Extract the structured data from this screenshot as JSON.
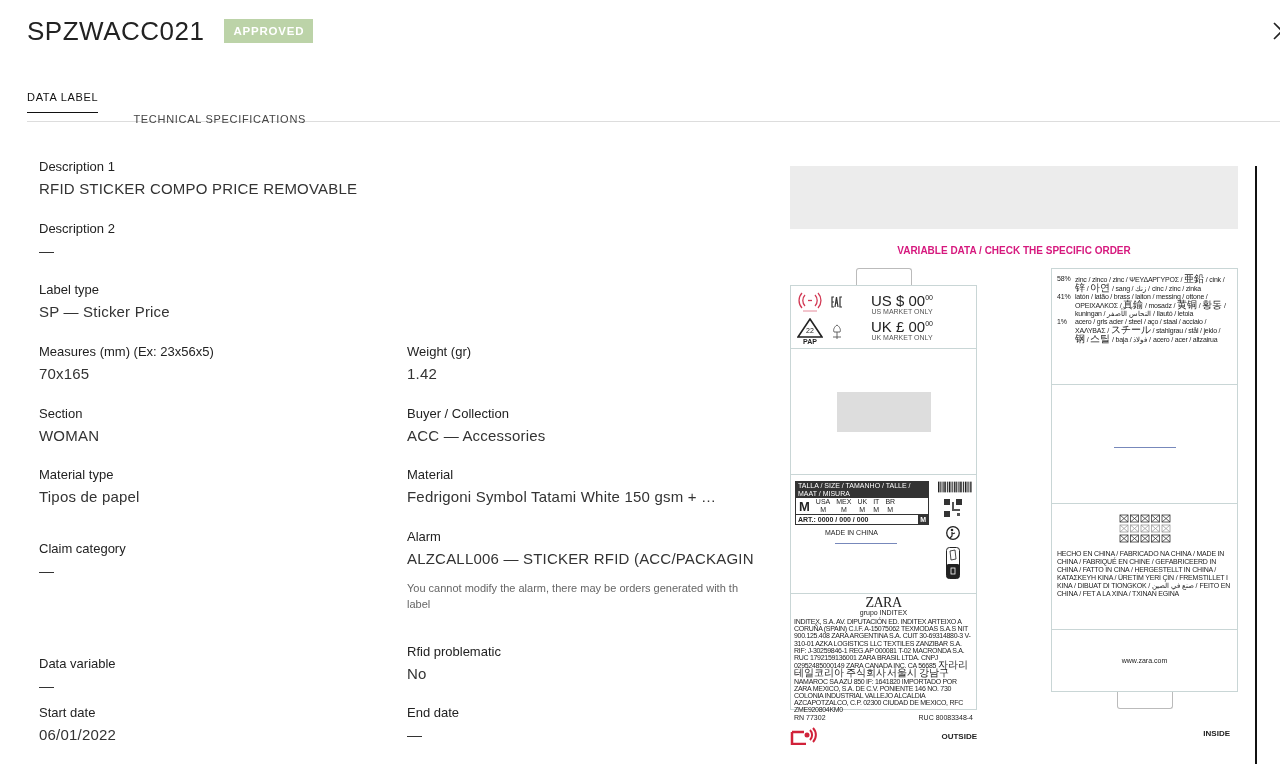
{
  "header": {
    "title": "SPZWACC021",
    "status": "APPROVED"
  },
  "tabs": [
    {
      "label": "DATA LABEL",
      "selected": true
    },
    {
      "label": "TECHNICAL SPECIFICATIONS",
      "selected": false
    }
  ],
  "fields": [
    {
      "left": {
        "label": "Description 1",
        "value": "RFID STICKER COMPO PRICE REMOVABLE"
      }
    },
    {
      "left": {
        "label": "Description 2",
        "value": "—"
      }
    },
    {
      "left": {
        "label": "Label type",
        "value": "SP — Sticker Price"
      }
    },
    {
      "left": {
        "label": "Measures (mm) (Ex: 23x56x5)",
        "value": "70x165"
      },
      "right": {
        "label": "Weight (gr)",
        "value": "1.42"
      }
    },
    {
      "left": {
        "label": "Section",
        "value": "WOMAN"
      },
      "right": {
        "label": "Buyer / Collection",
        "value": "ACC — Accessories"
      }
    },
    {
      "left": {
        "label": "Material type",
        "value": "Tipos de papel"
      },
      "right": {
        "label": "Material",
        "value": "Fedrigoni Symbol Tatami White 150 gsm + …"
      }
    },
    {
      "left": {
        "label": "Claim category",
        "value": "—"
      },
      "right": {
        "label": "Alarm",
        "value": "ALZCALL006 — STICKER RFID (ACC/PACKAGIN",
        "note": [
          "You cannot modify the alarm, there may be orders generated with th",
          "label"
        ]
      }
    },
    {
      "left": {
        "label": "Data variable",
        "value": "—"
      },
      "right": {
        "label": "Rfid problematic",
        "value": "No"
      }
    },
    {
      "left": {
        "label": "Start date",
        "value": "06/01/2022"
      },
      "right": {
        "label": "End date",
        "value": "—"
      }
    }
  ],
  "preview": {
    "banner": "VARIABLE DATA / CHECK THE SPECIFIC ORDER",
    "outside": {
      "caption": "OUTSIDE",
      "recycle_code": "22",
      "recycle_material": "PAP",
      "prices": [
        {
          "currency": "US $",
          "amount": "00",
          "cents": "00",
          "note": "US MARKET ONLY"
        },
        {
          "currency": "UK £",
          "amount": "00",
          "cents": "00",
          "note": "UK MARKET ONLY"
        }
      ],
      "size_header": "TALLA / SIZE / TAMANHO / TALLE / MAAT / MISURA",
      "size": "M",
      "sizes": [
        {
          "region": "USA",
          "size": "M"
        },
        {
          "region": "MEX",
          "size": "M"
        },
        {
          "region": "UK",
          "size": "M"
        },
        {
          "region": "IT",
          "size": "M"
        },
        {
          "region": "BR",
          "size": "M"
        }
      ],
      "article": "ART.: 0000 / 000 / 000",
      "size_badge": "M",
      "origin": "MADE IN CHINA",
      "brand": "ZARA",
      "group": "grupo INDITEX",
      "legal": "INDITEX, S.A. AV. DIPUTACIÓN ED. INDITEX ARTEIXO A CORUÑA (SPAIN) C.I.F. A-15075062 TEXMODAS S.A.S NIT 900.125.408 ZARA ARGENTINA S.A. CUIT 30-69314880-3 V-310-01 AZKA LOGISTICS LLC TEXTILES ZANZIBAR S.A. RIF: J-30259846-1 REG.AP 000081 T-02 MACRONDA S.A. RUC 1792159136001 ZARA BRASIL LTDA. CNPJ 02952485000149 ZARA CANADA INC. CA 56685 자라리테일코리아 주식회사 서울시 강남구 NAMAROC SA AZU 850 IF: 1641820 IMPORTADO POR ZARA MEXICO, S.A. DE C.V. PONIENTE 146 NO. 730 COLONIA INDUSTRIAL VALLEJO ALCALDIA AZCAPOTZALCO, C.P. 02300 CIUDAD DE MEXICO, RFC ZME920804KM0",
      "rn": "RN 77302",
      "ruc": "RUC 80083348-4"
    },
    "inside": {
      "caption": "INSIDE",
      "composition": [
        {
          "percent": "58%",
          "text": "zinc / zinco / zinc / ΨΕΥΔΑΡΓΥΡΟΣ / 亜鉛 / cink / 锌 / 아연 / sang / زنك / cinc / zinc / zinka"
        },
        {
          "percent": "41%",
          "text": "latón / latão / brass / laiton / messing / ottone / ΟΡΕΙΧΑΛΚΟΣ / 真鍮 / mosadz / 黄铜 / 황동 / kuningan / النحاس الأصفر / llautó / letoia"
        },
        {
          "percent": "1%",
          "text": "acero / gris acier / steel / aço / staal / acciaio / ΧΑΛΥΒΑΣ / スチール / stahlgrau / stål / jeklo / 钢 / 스틸 / baja / فولاذ / acero / acer / altzairua"
        }
      ],
      "origin": "HECHO EN CHINA / FABRICADO NA CHINA / MADE IN CHINA / FABRIQUÉ EN CHINE / GEFABRICEERD IN CHINA / FATTO IN CINA / HERGESTELLT IN CHINA / ΚΑΤΑΣΚΕΥΗ ΚΙΝΑ / ÜRETİM YERİ ÇİN / FREMSTILLET I KINA / DIBUAT DI TIONGKOK / صنع في الصين / FEITO EN CHINA / FET A LA XINA / TXINAN EGINA",
      "web": "www.zara.com"
    }
  }
}
